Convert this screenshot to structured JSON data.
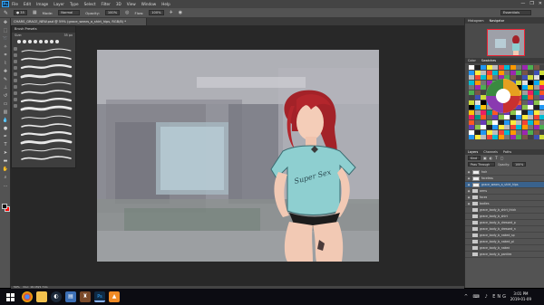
{
  "app": {
    "logo": "Ps",
    "menu": [
      "File",
      "Edit",
      "Image",
      "Layer",
      "Type",
      "Select",
      "Filter",
      "3D",
      "View",
      "Window",
      "Help"
    ],
    "window_controls": [
      "—",
      "❐",
      "✕"
    ]
  },
  "options": {
    "mode_label": "Mode:",
    "mode_value": "Normal",
    "opacity_label": "Opacity:",
    "opacity_value": "100%",
    "flow_label": "Flow:",
    "flow_value": "100%",
    "workspace": "Essentials"
  },
  "document": {
    "tab_title": "CHARS_GRACE_NEW.psd @ 59% (grace_wears_a_shirt_hips, RGB/8) *",
    "zoom_status": "59%",
    "doc_info": "Doc: 16.1M/1.71G"
  },
  "brush_panel": {
    "title": "Brush Presets",
    "size_label": "Size:",
    "size_value": "35 px",
    "preset_count": 14
  },
  "right_panel": {
    "navigator_tabs": [
      "Histogram",
      "Navigator"
    ],
    "swatches_tabs": [
      "Color",
      "Swatches"
    ],
    "layers_tabs": [
      "Layers",
      "Channels",
      "Paths"
    ],
    "kind_label": "Kind",
    "blend_mode": "Pass Through",
    "opacity_label": "Opacity:",
    "opacity_value": "100%",
    "layers": [
      {
        "name": "hair",
        "type": "layer",
        "visible": true
      },
      {
        "name": "faceless",
        "type": "layer",
        "visible": true
      },
      {
        "name": "grace_wears_a_shirt_hips",
        "type": "layer",
        "visible": true,
        "selected": true
      },
      {
        "name": "arms",
        "type": "folder",
        "visible": true
      },
      {
        "name": "faces",
        "type": "folder",
        "visible": true
      },
      {
        "name": "bodies",
        "type": "folder",
        "visible": true
      },
      {
        "name": "grace_body_b_shirt_thick",
        "type": "folder",
        "visible": false
      },
      {
        "name": "grace_body_b_shirt",
        "type": "folder",
        "visible": false
      },
      {
        "name": "grace_body_b_dressed_p",
        "type": "folder",
        "visible": false
      },
      {
        "name": "grace_body_b_dressed_n",
        "type": "folder",
        "visible": false
      },
      {
        "name": "grace_body_b_naked_sp",
        "type": "folder",
        "visible": false
      },
      {
        "name": "grace_body_b_naked_pi",
        "type": "folder",
        "visible": false
      },
      {
        "name": "grace_body_b_naked",
        "type": "folder",
        "visible": false
      },
      {
        "name": "grace_body_b_panties",
        "type": "folder",
        "visible": false
      }
    ]
  },
  "canvas_art": {
    "shirt_text": "Super Sex"
  },
  "taskbar": {
    "start_icon": "windows-logo",
    "apps": [
      "chrome",
      "explorer",
      "steam",
      "file-explorer",
      "game",
      "photoshop",
      "vlc"
    ],
    "tray": "^ ⌨ ♪ ENG",
    "time": "3:01 PM",
    "date": "2019-01-09"
  },
  "colors": {
    "ui_dark": "#535353",
    "selection": "#39628d",
    "hair": "#b3262c",
    "shirt": "#8ecfd0"
  }
}
